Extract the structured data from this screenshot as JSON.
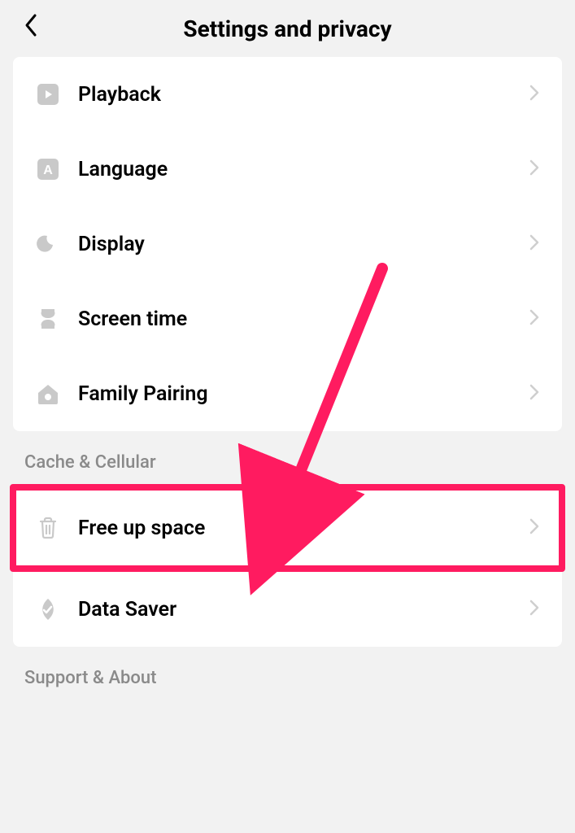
{
  "header": {
    "title": "Settings and privacy"
  },
  "sections": [
    {
      "items": [
        {
          "icon": "playback",
          "label": "Playback"
        },
        {
          "icon": "language",
          "label": "Language"
        },
        {
          "icon": "display",
          "label": "Display"
        },
        {
          "icon": "screentime",
          "label": "Screen time"
        },
        {
          "icon": "family",
          "label": "Family Pairing"
        }
      ]
    },
    {
      "title": "Cache & Cellular",
      "items": [
        {
          "icon": "trash",
          "label": "Free up space",
          "highlighted": true
        },
        {
          "icon": "datasaver",
          "label": "Data Saver"
        }
      ]
    },
    {
      "title": "Support & About",
      "items": []
    }
  ],
  "annotation": {
    "color": "#ff1b60"
  }
}
